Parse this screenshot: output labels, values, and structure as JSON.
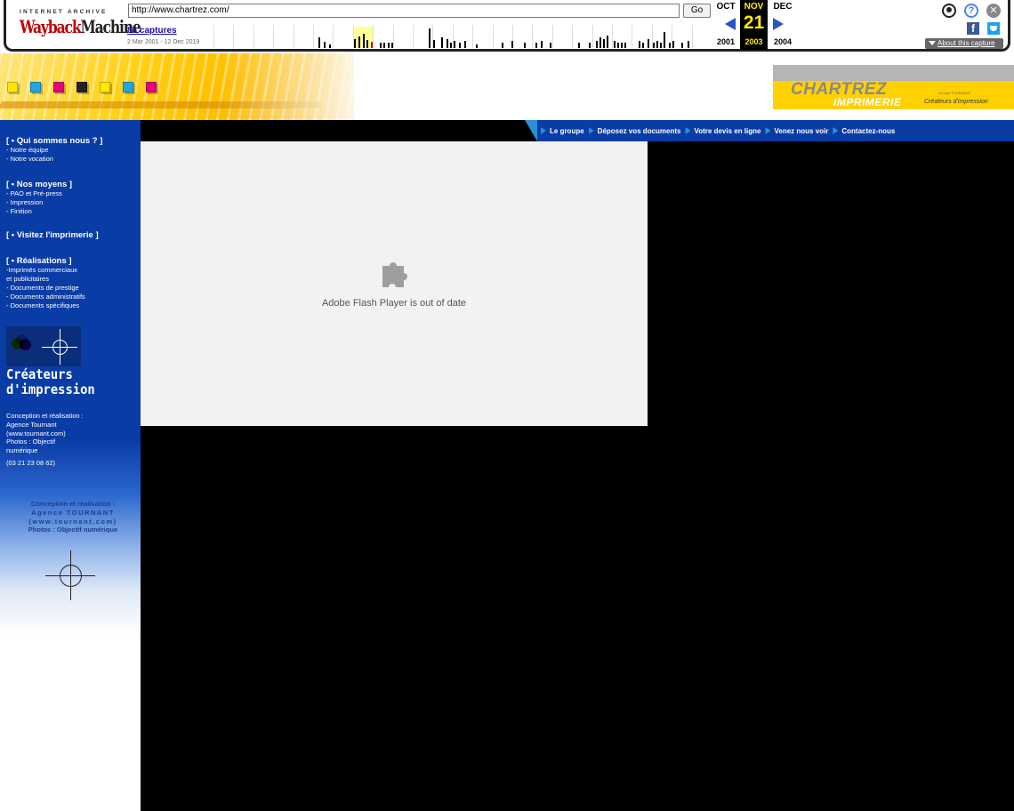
{
  "wayback": {
    "logo_top": "INTERNET ARCHIVE",
    "logo_wayback": "Wayback",
    "logo_machine": "Machine",
    "url": "http://www.chartrez.com/",
    "go_label": "Go",
    "captures_label": "88 captures",
    "date_range": "2 Mar 2001 - 12 Dec 2019",
    "prev_month": "OCT",
    "current_month": "NOV",
    "next_month": "DEC",
    "current_day": "21",
    "prev_year": "2001",
    "current_year": "2003",
    "next_year": "2004",
    "about_label": "About this capture",
    "facebook_glyph": "f"
  },
  "header": {
    "brand_name": "CHARTREZ",
    "brand_sub": "IMPRIMERIE",
    "brand_tagline": "Créateurs d'impression",
    "brand_group": "Groupe TOURNANT",
    "swatch_colors": [
      "#ffe600",
      "#1fa7e0",
      "#e6007e",
      "#222222",
      "#ffe600",
      "#1fa7e0",
      "#e6007e"
    ]
  },
  "sidebar": {
    "sections": [
      {
        "heading": "[ • Qui sommes nous ? ]",
        "links": [
          "- Notre équipe",
          "- Notre vocation"
        ]
      },
      {
        "heading": "[ • Nos moyens ]",
        "links": [
          "- PAO et Pré-press",
          "- Impression",
          "- Finition"
        ]
      },
      {
        "heading": "[ • Visitez l'imprimerie ]",
        "links": []
      },
      {
        "heading": "[ • Réalisations ]",
        "links": [
          "-Imprimés commerciaux",
          "et publicitaires",
          "- Documents de prestige",
          "- Documents administratifs",
          "- Documents spécifiques"
        ]
      }
    ],
    "createurs_line1": "Créateurs",
    "createurs_line2": "d'impression",
    "credits": [
      "Conception et réalisation :",
      "Agence Tournant",
      "(www.tournant.com)",
      "Photos : Objectif",
      "numérique"
    ],
    "phone": "(03 21 23 08 62)",
    "credits2": [
      "Conception et réalisation :",
      "Agence TOURNANT",
      "(www.tournant.com)",
      "Photos : Objectif numérique"
    ]
  },
  "topnav": {
    "items": [
      "Le groupe",
      "Déposez vos documents",
      "Votre devis en ligne",
      "Venez nous voir",
      "Contactez-nous"
    ]
  },
  "flash": {
    "message": "Adobe Flash Player is out of date"
  }
}
